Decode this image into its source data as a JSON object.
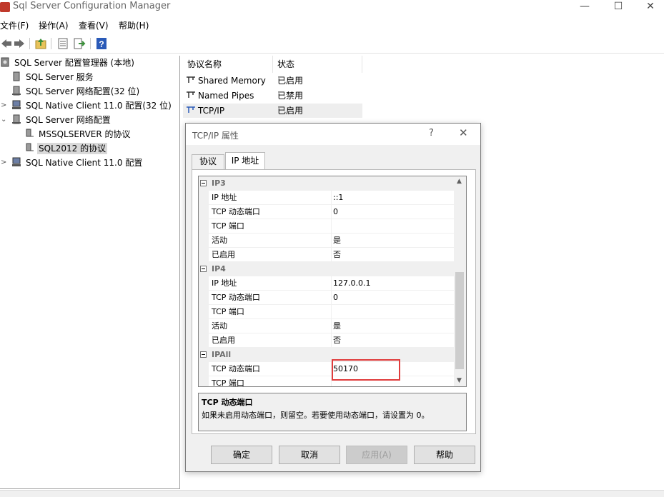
{
  "window": {
    "title": "Sql Server Configuration Manager",
    "minimize": "—",
    "maximize": "☐",
    "close": "✕"
  },
  "menu": [
    "文件(F)",
    "操作(A)",
    "查看(V)",
    "帮助(H)"
  ],
  "toolbar": {
    "icons": [
      "back-icon",
      "forward-icon",
      "up-folder-icon",
      "properties-icon",
      "export-icon",
      "help-icon"
    ]
  },
  "tree": {
    "items": [
      {
        "label": "SQL Server 配置管理器 (本地)"
      },
      {
        "label": "SQL Server 服务"
      },
      {
        "label": "SQL Server 网络配置(32 位)"
      },
      {
        "label": "SQL Native Client 11.0 配置(32 位)"
      },
      {
        "label": "SQL Server 网络配置"
      },
      {
        "label": "MSSQLSERVER 的协议"
      },
      {
        "label": "SQL2012 的协议"
      },
      {
        "label": "SQL Native Client 11.0 配置"
      }
    ],
    "expanders": [
      ">",
      "⌄",
      ">",
      ">"
    ]
  },
  "list": {
    "headers": [
      "协议名称",
      "状态"
    ],
    "rows": [
      {
        "name": "Shared Memory",
        "status": "已启用"
      },
      {
        "name": "Named Pipes",
        "status": "已禁用"
      },
      {
        "name": "TCP/IP",
        "status": "已启用"
      }
    ]
  },
  "dialog": {
    "title": "TCP/IP 属性",
    "help": "?",
    "close": "✕",
    "tabs": [
      "协议",
      "IP 地址"
    ],
    "active_tab": "IP 地址",
    "groups": [
      {
        "name": "IP3",
        "props": [
          {
            "name": "IP 地址",
            "value": "::1"
          },
          {
            "name": "TCP 动态端口",
            "value": "0"
          },
          {
            "name": "TCP 端口",
            "value": ""
          },
          {
            "name": "活动",
            "value": "是"
          },
          {
            "name": "已启用",
            "value": "否"
          }
        ]
      },
      {
        "name": "IP4",
        "props": [
          {
            "name": "IP 地址",
            "value": "127.0.0.1"
          },
          {
            "name": "TCP 动态端口",
            "value": "0"
          },
          {
            "name": "TCP 端口",
            "value": ""
          },
          {
            "name": "活动",
            "value": "是"
          },
          {
            "name": "已启用",
            "value": "否"
          }
        ]
      },
      {
        "name": "IPAll",
        "props": [
          {
            "name": "TCP 动态端口",
            "value": "50170"
          },
          {
            "name": "TCP 端口",
            "value": ""
          }
        ]
      }
    ],
    "scroll_up": "▲",
    "scroll_down": "▼",
    "description": {
      "title": "TCP 动态端口",
      "text": "如果未启用动态端口，则留空。若要使用动态端口，请设置为 0。"
    },
    "buttons": {
      "ok": "确定",
      "cancel": "取消",
      "apply": "应用(A)",
      "help": "帮助"
    }
  },
  "colors": {
    "highlight_box": "#e03c3c",
    "selection": "#d9d9d9"
  }
}
